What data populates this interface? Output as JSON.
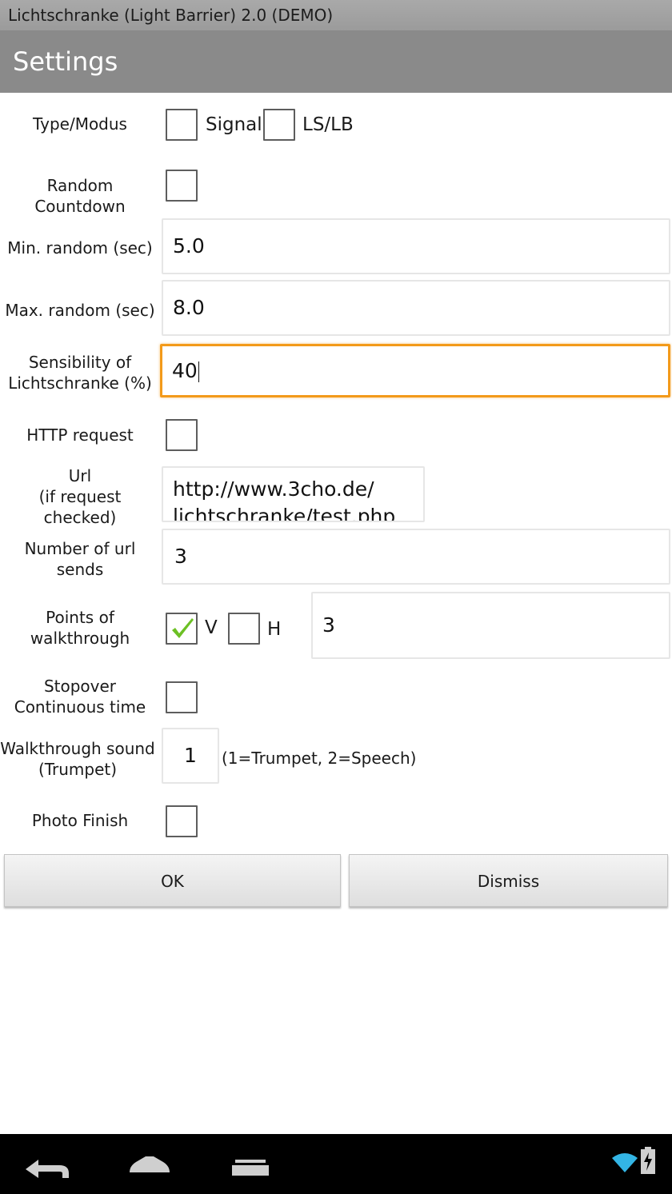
{
  "app_title": "Lichtschranke (Light Barrier) 2.0 (DEMO)",
  "header": {
    "title": "Settings"
  },
  "type_modus": {
    "label": "Type/Modus",
    "options": [
      {
        "label": "Signal",
        "checked": false
      },
      {
        "label": "LS/LB",
        "checked": false
      }
    ]
  },
  "random_countdown": {
    "label": "Random Countdown",
    "checked": false
  },
  "min_random": {
    "label": "Min. random (sec)",
    "value": "5.0"
  },
  "max_random": {
    "label": "Max. random (sec)",
    "value": "8.0"
  },
  "sensibility": {
    "label_line1": "Sensibility of",
    "label_line2": "Lichtschranke (%)",
    "value": "40"
  },
  "http_request": {
    "label": "HTTP request",
    "checked": false
  },
  "url": {
    "label_line1": "Url",
    "label_line2": "(if request",
    "label_line3": "checked)",
    "value_line1": "http://www.3cho.de/",
    "value_line2": "lichtschranke/test.php"
  },
  "url_sends": {
    "label_line1": "Number of url",
    "label_line2": "sends",
    "value": "3"
  },
  "points": {
    "label_line1": "Points of",
    "label_line2": "walkthrough",
    "v_label": "V",
    "v_checked": true,
    "h_label": "H",
    "h_checked": false,
    "value": "3"
  },
  "stopover": {
    "label_line1": "Stopover",
    "label_line2": "Continuous time",
    "checked": false
  },
  "walkthrough_sound": {
    "label_line1": "Walkthrough sound",
    "label_line2": "(Trumpet)",
    "value": "1",
    "hint": "(1=Trumpet, 2=Speech)"
  },
  "photo_finish": {
    "label": "Photo Finish",
    "checked": false
  },
  "buttons": {
    "ok": "OK",
    "dismiss": "Dismiss"
  },
  "colors": {
    "focus": "#f39a1a",
    "check": "#6cc024",
    "status_icon": "#33b5e5"
  },
  "nav_icons": [
    "back-icon",
    "home-icon",
    "recent-apps-icon"
  ],
  "status_icons": [
    "wifi-icon",
    "battery-charging-icon"
  ]
}
